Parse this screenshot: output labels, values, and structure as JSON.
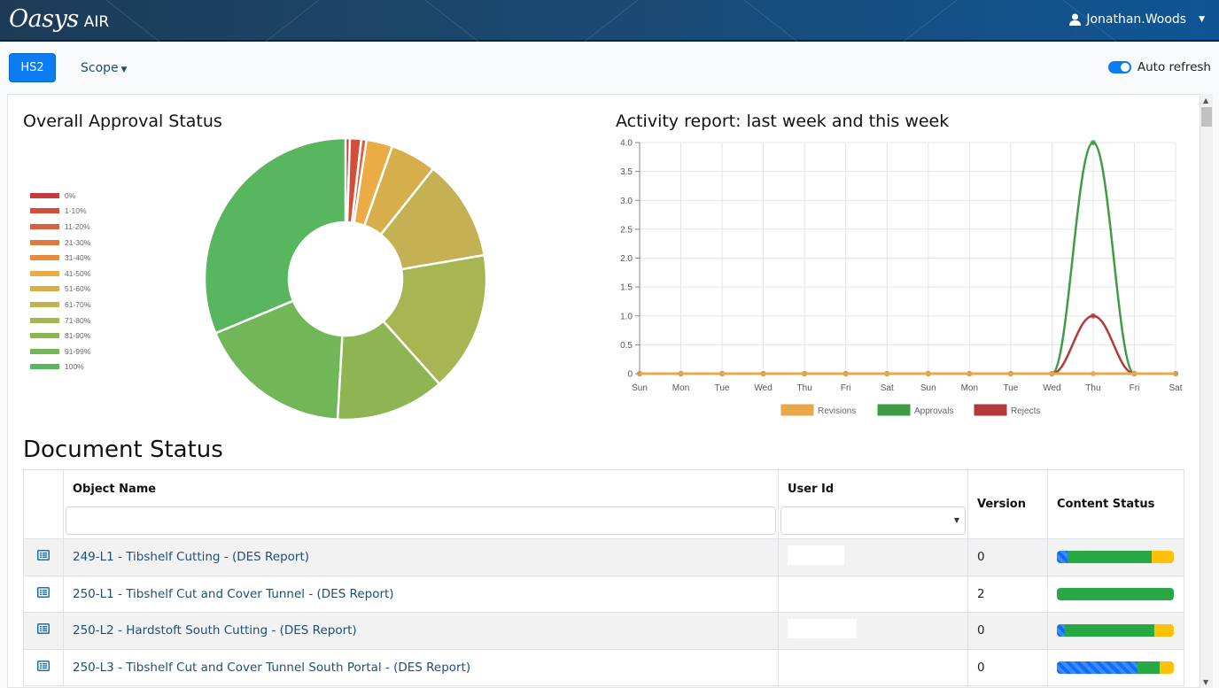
{
  "header": {
    "brand_main": "Oasys",
    "brand_sub": "AIR",
    "user_name": "Jonathan.Woods"
  },
  "toolbar": {
    "project_button": "HS2",
    "scope_label": "Scope",
    "auto_refresh_label": "Auto refresh",
    "auto_refresh_on": true
  },
  "approval": {
    "title": "Overall Approval Status"
  },
  "activity": {
    "title": "Activity report: last week and this week"
  },
  "chart_data": [
    {
      "type": "pie",
      "title": "Overall Approval Status",
      "donut": true,
      "legend_position": "left",
      "categories": [
        "0%",
        "1-10%",
        "11-20%",
        "21-30%",
        "31-40%",
        "41-50%",
        "51-60%",
        "61-70%",
        "71-80%",
        "81-90%",
        "91-99%",
        "100%"
      ],
      "colors": [
        "#c43c3c",
        "#cf4f3a",
        "#d8623c",
        "#df7a3f",
        "#e48c42",
        "#ecac45",
        "#d6ae4c",
        "#c3b153",
        "#a7b553",
        "#8db653",
        "#72b65a",
        "#58b75e"
      ],
      "values": [
        0.5,
        1.3,
        0.6,
        0,
        0,
        3.0,
        5.3,
        11.6,
        16.1,
        12.5,
        17.8,
        31.3
      ]
    },
    {
      "type": "line",
      "title": "Activity report: last week and this week",
      "categories": [
        "Sun",
        "Mon",
        "Tue",
        "Wed",
        "Thu",
        "Fri",
        "Sat",
        "Sun",
        "Mon",
        "Tue",
        "Wed",
        "Thu",
        "Fri",
        "Sat"
      ],
      "ylim": [
        0,
        4.0
      ],
      "yticks": [
        "0",
        "0.5",
        "1.0",
        "1.5",
        "2.0",
        "2.5",
        "3.0",
        "3.5",
        "4.0"
      ],
      "grid": true,
      "legend_position": "bottom",
      "series": [
        {
          "name": "Revisions",
          "color": "#e8a84a",
          "values": [
            0,
            0,
            0,
            0,
            0,
            0,
            0,
            0,
            0,
            0,
            0,
            0,
            0,
            0
          ]
        },
        {
          "name": "Approvals",
          "color": "#3f9c44",
          "values": [
            0,
            0,
            0,
            0,
            0,
            0,
            0,
            0,
            0,
            0,
            0,
            4,
            0,
            0
          ]
        },
        {
          "name": "Rejects",
          "color": "#b33a3a",
          "values": [
            0,
            0,
            0,
            0,
            0,
            0,
            0,
            0,
            0,
            0,
            0,
            1,
            0,
            0
          ]
        }
      ]
    }
  ],
  "documents": {
    "title": "Document Status",
    "columns": [
      "",
      "Object Name",
      "User Id",
      "Version",
      "Content Status"
    ],
    "rows": [
      {
        "name": "249-L1 - Tibshelf Cutting - (DES Report)",
        "version": "0",
        "status": {
          "blue": 0.09,
          "green": 0.72,
          "yellow": 0.19
        }
      },
      {
        "name": "250-L1 - Tibshelf Cut and Cover Tunnel - (DES Report)",
        "version": "2",
        "status": {
          "blue": 0,
          "green": 1.0,
          "yellow": 0
        }
      },
      {
        "name": "250-L2 - Hardstoft South Cutting - (DES Report)",
        "version": "0",
        "status": {
          "blue": 0.07,
          "green": 0.76,
          "yellow": 0.17
        }
      },
      {
        "name": "250-L3 - Tibshelf Cut and Cover Tunnel South Portal - (DES Report)",
        "version": "0",
        "status": {
          "blue": 0.69,
          "green": 0.19,
          "yellow": 0.12
        }
      }
    ]
  }
}
